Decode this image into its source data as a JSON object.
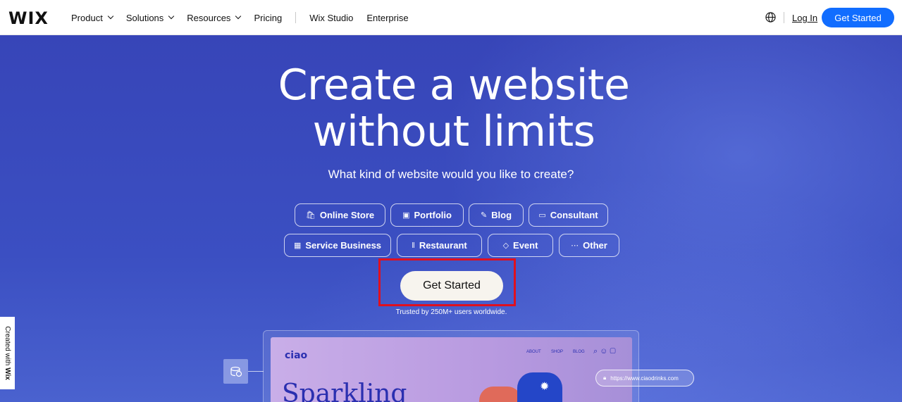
{
  "header": {
    "logo": "WIX",
    "nav": [
      {
        "label": "Product",
        "dropdown": true
      },
      {
        "label": "Solutions",
        "dropdown": true
      },
      {
        "label": "Resources",
        "dropdown": true
      },
      {
        "label": "Pricing",
        "dropdown": false
      }
    ],
    "nav_secondary": [
      {
        "label": "Wix Studio"
      },
      {
        "label": "Enterprise"
      }
    ],
    "language_icon": "globe-icon",
    "login_label": "Log In",
    "cta_label": "Get Started"
  },
  "hero": {
    "headline_line1": "Create a website",
    "headline_line2": "without limits",
    "subheading": "What kind of website would you like to create?",
    "categories_row1": [
      {
        "label": "Online Store",
        "icon": "shop-icon"
      },
      {
        "label": "Portfolio",
        "icon": "portfolio-icon"
      },
      {
        "label": "Blog",
        "icon": "pen-icon"
      },
      {
        "label": "Consultant",
        "icon": "briefcase-icon"
      }
    ],
    "categories_row2": [
      {
        "label": "Service Business",
        "icon": "calendar-icon"
      },
      {
        "label": "Restaurant",
        "icon": "utensils-icon"
      },
      {
        "label": "Event",
        "icon": "ticket-icon"
      },
      {
        "label": "Other",
        "icon": "dots-icon"
      }
    ],
    "cta_label": "Get Started",
    "trusted_text": "Trusted by 250M+ users worldwide."
  },
  "preview": {
    "brand": "ciao",
    "nav": [
      "ABOUT",
      "SHOP",
      "BLOG"
    ],
    "headline": "Sparkling",
    "url": "https://www.ciaodrinks.com"
  },
  "badge": {
    "prefix": "Created with ",
    "brand": "Wix"
  },
  "colors": {
    "hero_bg": "#3a4ec0",
    "primary_button": "#116dff",
    "highlight_box": "#e0101e",
    "preview_brand": "#2a2fb0"
  }
}
